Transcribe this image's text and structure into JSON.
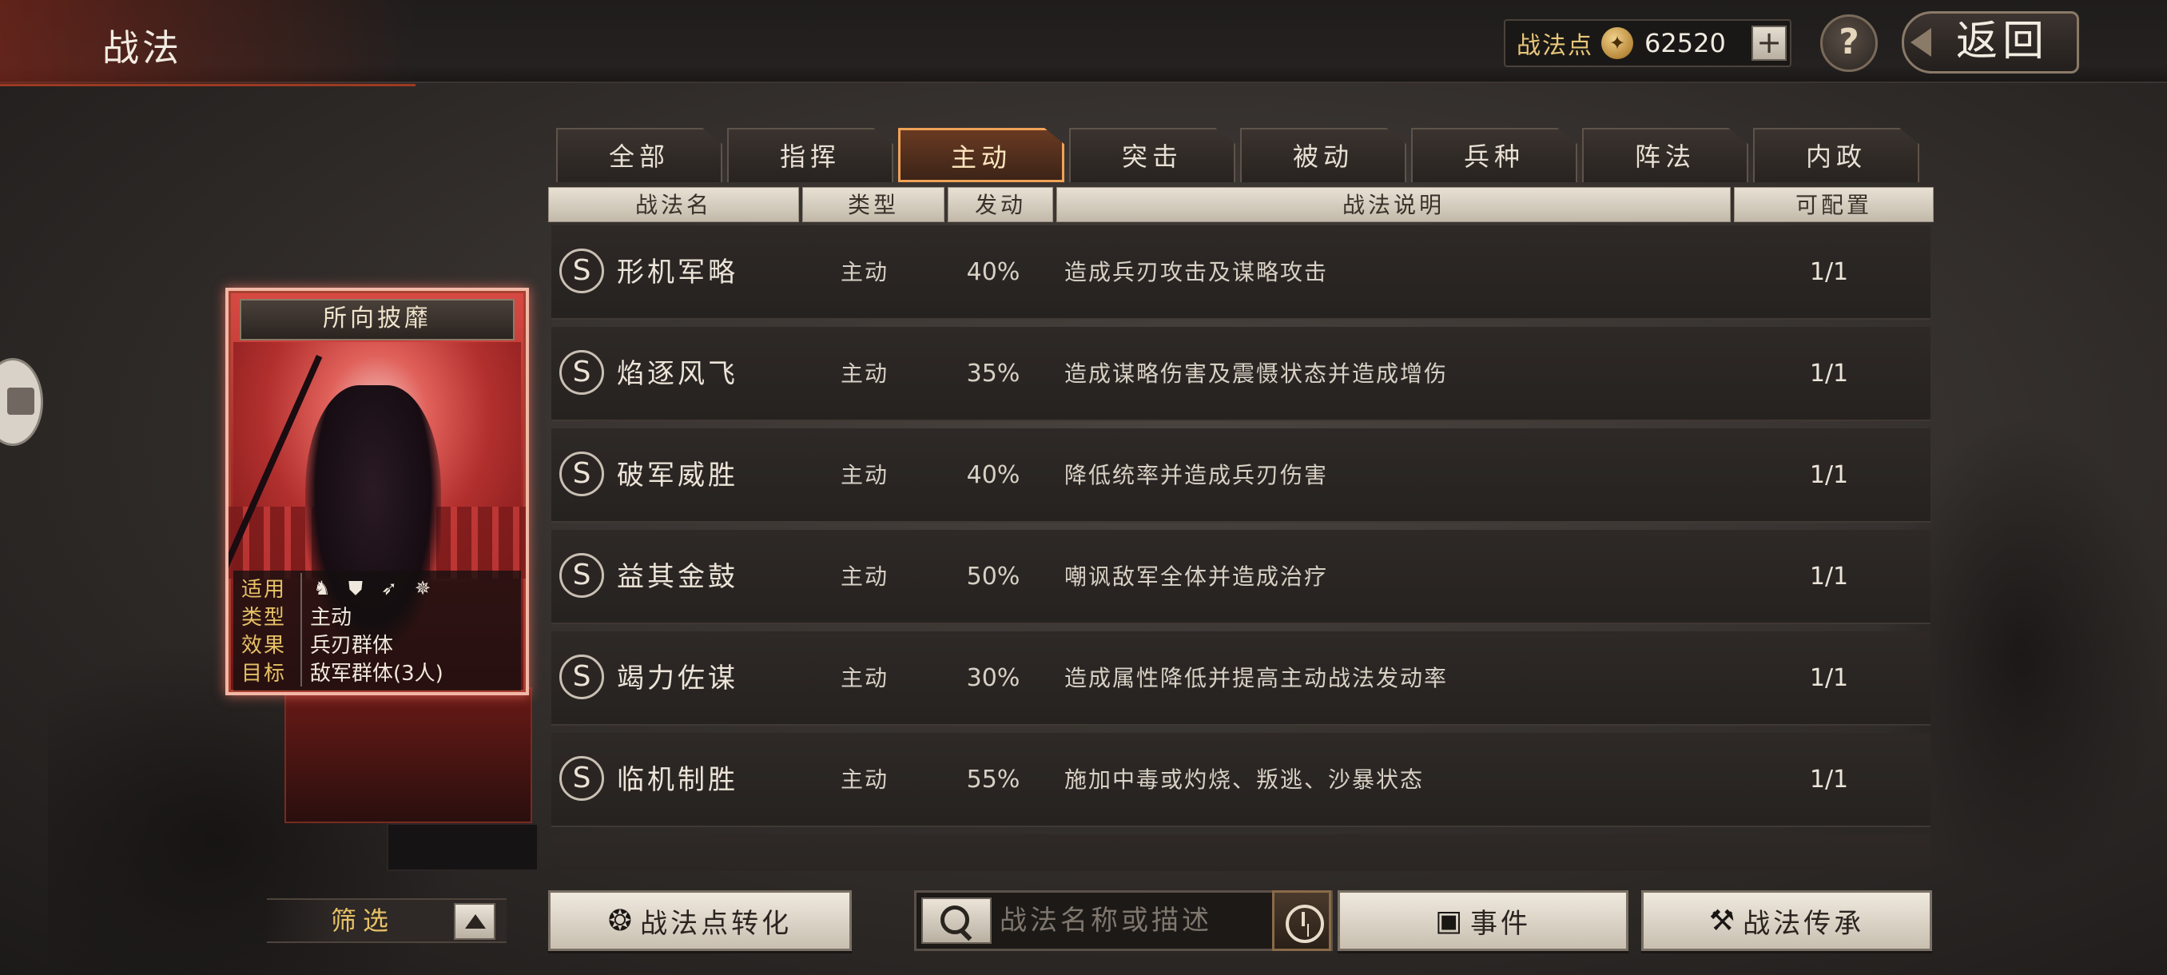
{
  "header": {
    "title": "战法",
    "points_label": "战法点",
    "points_value": "62520",
    "plus_label": "+",
    "help_label": "?",
    "back_label": "返回"
  },
  "tabs": [
    {
      "label": "全部"
    },
    {
      "label": "指挥"
    },
    {
      "label": "主动",
      "active": true
    },
    {
      "label": "突击"
    },
    {
      "label": "被动"
    },
    {
      "label": "兵种"
    },
    {
      "label": "阵法"
    },
    {
      "label": "内政"
    }
  ],
  "table": {
    "columns": [
      "战法名",
      "类型",
      "发动",
      "战法说明",
      "可配置"
    ],
    "rows": [
      {
        "badge": "S",
        "name": "形机军略",
        "type": "主动",
        "rate": "40%",
        "desc": "造成兵刃攻击及谋略攻击",
        "config": "1/1"
      },
      {
        "badge": "S",
        "name": "焰逐风飞",
        "type": "主动",
        "rate": "35%",
        "desc": "造成谋略伤害及震慑状态并造成增伤",
        "config": "1/1"
      },
      {
        "badge": "S",
        "name": "破军威胜",
        "type": "主动",
        "rate": "40%",
        "desc": "降低统率并造成兵刃伤害",
        "config": "1/1"
      },
      {
        "badge": "S",
        "name": "益其金鼓",
        "type": "主动",
        "rate": "50%",
        "desc": "嘲讽敌军全体并造成治疗",
        "config": "1/1"
      },
      {
        "badge": "S",
        "name": "竭力佐谋",
        "type": "主动",
        "rate": "30%",
        "desc": "造成属性降低并提高主动战法发动率",
        "config": "1/1"
      },
      {
        "badge": "S",
        "name": "临机制胜",
        "type": "主动",
        "rate": "55%",
        "desc": "施加中毒或灼烧、叛逃、沙暴状态",
        "config": "1/1"
      }
    ]
  },
  "card": {
    "title": "所向披靡",
    "info": [
      {
        "key": "适用",
        "value": ""
      },
      {
        "key": "类型",
        "value": "主动"
      },
      {
        "key": "效果",
        "value": "兵刃群体"
      },
      {
        "key": "目标",
        "value": "敌军群体(3人)"
      }
    ],
    "unit_icons": [
      "cavalry-icon",
      "shield-icon",
      "bow-icon",
      "chariot-icon"
    ]
  },
  "bottom": {
    "filter_label": "筛选",
    "convert_label": "战法点转化",
    "search_placeholder": "战法名称或描述",
    "events_label": "事件",
    "inherit_label": "战法传承"
  },
  "colors": {
    "accent_gold": "#e6c166",
    "active_tab_border": "#f0a256",
    "card_red": "#a72a2a"
  }
}
